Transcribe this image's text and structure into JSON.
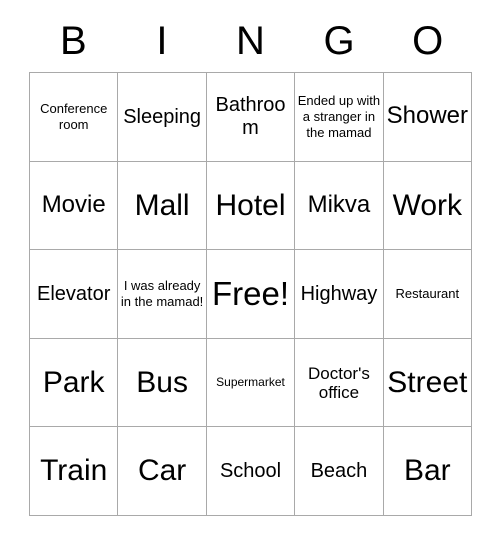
{
  "header": {
    "letters": [
      "B",
      "I",
      "N",
      "G",
      "O"
    ]
  },
  "grid": {
    "rows": [
      [
        {
          "label": "Conference room",
          "size": "fs-sm"
        },
        {
          "label": "Sleeping",
          "size": "fs-lg"
        },
        {
          "label": "Bathroom",
          "size": "fs-lg"
        },
        {
          "label": "Ended up with a stranger in the mamad",
          "size": "fs-sm"
        },
        {
          "label": "Shower",
          "size": "fs-xl"
        }
      ],
      [
        {
          "label": "Movie",
          "size": "fs-xl"
        },
        {
          "label": "Mall",
          "size": "fs-xxl"
        },
        {
          "label": "Hotel",
          "size": "fs-xxl"
        },
        {
          "label": "Mikva",
          "size": "fs-xl"
        },
        {
          "label": "Work",
          "size": "fs-xxl"
        }
      ],
      [
        {
          "label": "Elevator",
          "size": "fs-lg"
        },
        {
          "label": "I was already in the mamad!",
          "size": "fs-sm"
        },
        {
          "label": "Free!",
          "size": "fs-free"
        },
        {
          "label": "Highway",
          "size": "fs-lg"
        },
        {
          "label": "Restaurant",
          "size": "fs-sm"
        }
      ],
      [
        {
          "label": "Park",
          "size": "fs-xxl"
        },
        {
          "label": "Bus",
          "size": "fs-xxl"
        },
        {
          "label": "Supermarket",
          "size": "fs-xs"
        },
        {
          "label": "Doctor's office",
          "size": "fs-md"
        },
        {
          "label": "Street",
          "size": "fs-xxl"
        }
      ],
      [
        {
          "label": "Train",
          "size": "fs-xxl"
        },
        {
          "label": "Car",
          "size": "fs-xxl"
        },
        {
          "label": "School",
          "size": "fs-lg"
        },
        {
          "label": "Beach",
          "size": "fs-lg"
        },
        {
          "label": "Bar",
          "size": "fs-xxl"
        }
      ]
    ]
  },
  "colors": {
    "border": "#a9a9a9",
    "text": "#000000",
    "background": "#ffffff"
  }
}
